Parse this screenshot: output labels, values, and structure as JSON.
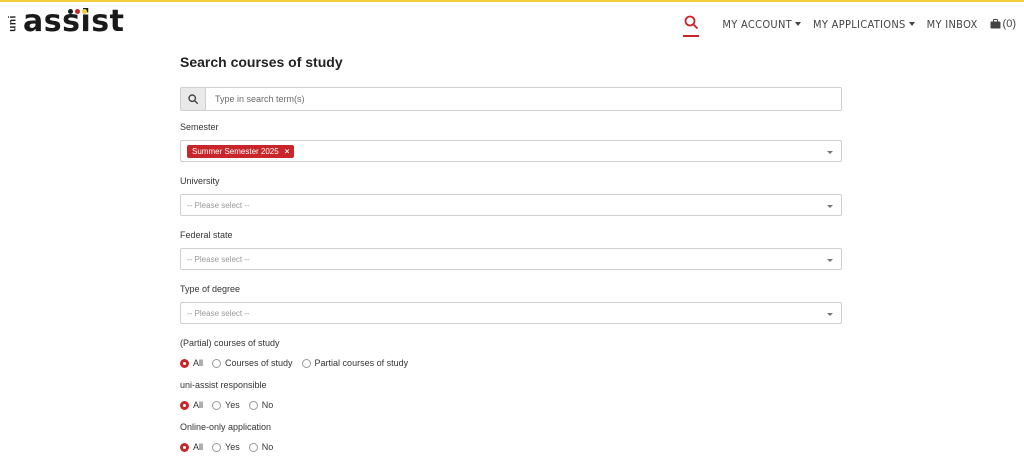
{
  "brand": {
    "prefix": "uni",
    "name": "assist",
    "dot_colors": [
      "#1a1a1a",
      "#c8262b",
      "#f2cf3a"
    ],
    "accent": "#c8262b"
  },
  "nav": {
    "search_icon": "search-icon",
    "my_account": "MY ACCOUNT",
    "my_applications": "MY APPLICATIONS",
    "my_inbox": "MY INBOX",
    "basket_count": "(0)"
  },
  "page": {
    "title": "Search courses of study",
    "search": {
      "placeholder": "Type in search term(s)"
    },
    "semester": {
      "label": "Semester",
      "selected_tag": "Summer Semester 2025",
      "remove": "×"
    },
    "university": {
      "label": "University",
      "placeholder": "-- Please select --"
    },
    "federal_state": {
      "label": "Federal state",
      "placeholder": "-- Please select --"
    },
    "degree_type": {
      "label": "Type of degree",
      "placeholder": "-- Please select --"
    },
    "courses": {
      "label": "(Partial) courses of study",
      "options": [
        "All",
        "Courses of study",
        "Partial courses of study"
      ],
      "selected": "All"
    },
    "responsible": {
      "label": "uni-assist responsible",
      "options": [
        "All",
        "Yes",
        "No"
      ],
      "selected": "All"
    },
    "online": {
      "label": "Online-only application",
      "options": [
        "All",
        "Yes",
        "No"
      ],
      "selected": "All"
    }
  }
}
